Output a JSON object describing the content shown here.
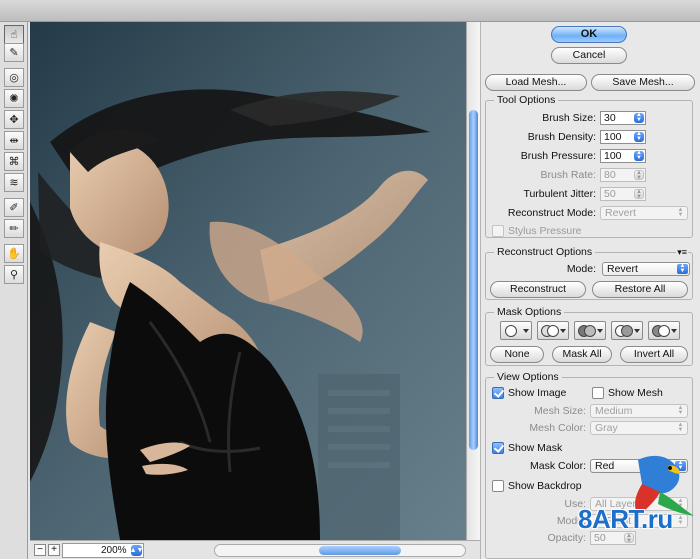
{
  "toolbox": {
    "tools": [
      {
        "name": "forward-warp-tool",
        "glyph": "☝",
        "active": true
      },
      {
        "name": "reconstruct-tool",
        "glyph": "✎",
        "active": false
      },
      {
        "name": "twirl-tool",
        "glyph": "◎",
        "active": false
      },
      {
        "name": "pucker-tool",
        "glyph": "✺",
        "active": false
      },
      {
        "name": "bloat-tool",
        "glyph": "✥",
        "active": false
      },
      {
        "name": "push-left-tool",
        "glyph": "⇹",
        "active": false
      },
      {
        "name": "mirror-tool",
        "glyph": "⌘",
        "active": false
      },
      {
        "name": "turbulence-tool",
        "glyph": "≋",
        "active": false
      },
      {
        "name": "freeze-mask-tool",
        "glyph": "✐",
        "active": false
      },
      {
        "name": "thaw-mask-tool",
        "glyph": "✏",
        "active": false
      },
      {
        "name": "hand-tool",
        "glyph": "✋",
        "active": false
      },
      {
        "name": "zoom-tool",
        "glyph": "⚲",
        "active": false
      }
    ]
  },
  "statusbar": {
    "zoom_out": "−",
    "zoom_in": "+",
    "zoom_value": "200%"
  },
  "actions": {
    "ok": "OK",
    "cancel": "Cancel",
    "load_mesh": "Load Mesh...",
    "save_mesh": "Save Mesh..."
  },
  "tool_options": {
    "legend": "Tool Options",
    "brush_size": {
      "label": "Brush Size:",
      "value": "30"
    },
    "brush_density": {
      "label": "Brush Density:",
      "value": "100"
    },
    "brush_pressure": {
      "label": "Brush Pressure:",
      "value": "100"
    },
    "brush_rate": {
      "label": "Brush Rate:",
      "value": "80"
    },
    "turbulent_jitter": {
      "label": "Turbulent Jitter:",
      "value": "50"
    },
    "reconstruct_mode": {
      "label": "Reconstruct Mode:",
      "value": "Revert"
    },
    "stylus_pressure": "Stylus Pressure"
  },
  "reconstruct_options": {
    "legend": "Reconstruct Options",
    "mode_label": "Mode:",
    "mode_value": "Revert",
    "reconstruct": "Reconstruct",
    "restore_all": "Restore All"
  },
  "mask_options": {
    "legend": "Mask Options",
    "none": "None",
    "mask_all": "Mask All",
    "invert_all": "Invert All"
  },
  "view_options": {
    "legend": "View Options",
    "show_image": "Show Image",
    "show_mesh": "Show Mesh",
    "mesh_size": {
      "label": "Mesh Size:",
      "value": "Medium"
    },
    "mesh_color": {
      "label": "Mesh Color:",
      "value": "Gray"
    },
    "show_mask": "Show Mask",
    "mask_color": {
      "label": "Mask Color:",
      "value": "Red"
    },
    "show_backdrop": "Show Backdrop",
    "use": {
      "label": "Use:",
      "value": "All Layers"
    },
    "mode": {
      "label": "Mode:",
      "value": "In Front"
    },
    "opacity": {
      "label": "Opacity:",
      "value": "50"
    }
  },
  "watermark": {
    "text": "8ART.ru"
  },
  "colors": {
    "accent_blue": "#3a82e6",
    "panel_bg": "#e8e8e8",
    "canvas_sky": "#4a6270"
  }
}
